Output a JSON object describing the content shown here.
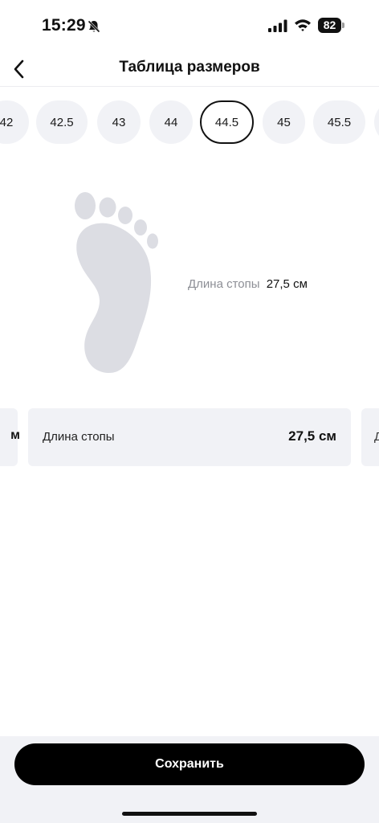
{
  "status_bar": {
    "time": "15:29",
    "battery_level": "82",
    "icons": [
      "bell-slash-icon",
      "cellular-signal-icon",
      "wifi-icon",
      "battery-icon"
    ]
  },
  "header": {
    "title": "Таблица размеров",
    "back_icon": "chevron-left-icon"
  },
  "sizes": {
    "items": [
      "42",
      "42.5",
      "43",
      "44",
      "44.5",
      "45",
      "45.5"
    ],
    "selected": "44.5"
  },
  "foot": {
    "icon": "foot-outline-icon",
    "label": "Длина стопы",
    "value": "27,5 см"
  },
  "cards": {
    "prev_edge_text": "м",
    "main_label": "Длина стопы",
    "main_value": "27,5 см",
    "next_edge_text": "Д"
  },
  "footer": {
    "save_label": "Сохранить"
  },
  "colors": {
    "chip_bg": "#f1f2f6",
    "accent": "#000000",
    "muted_text": "#8d8f96",
    "foot_fill": "#dcdde3"
  }
}
